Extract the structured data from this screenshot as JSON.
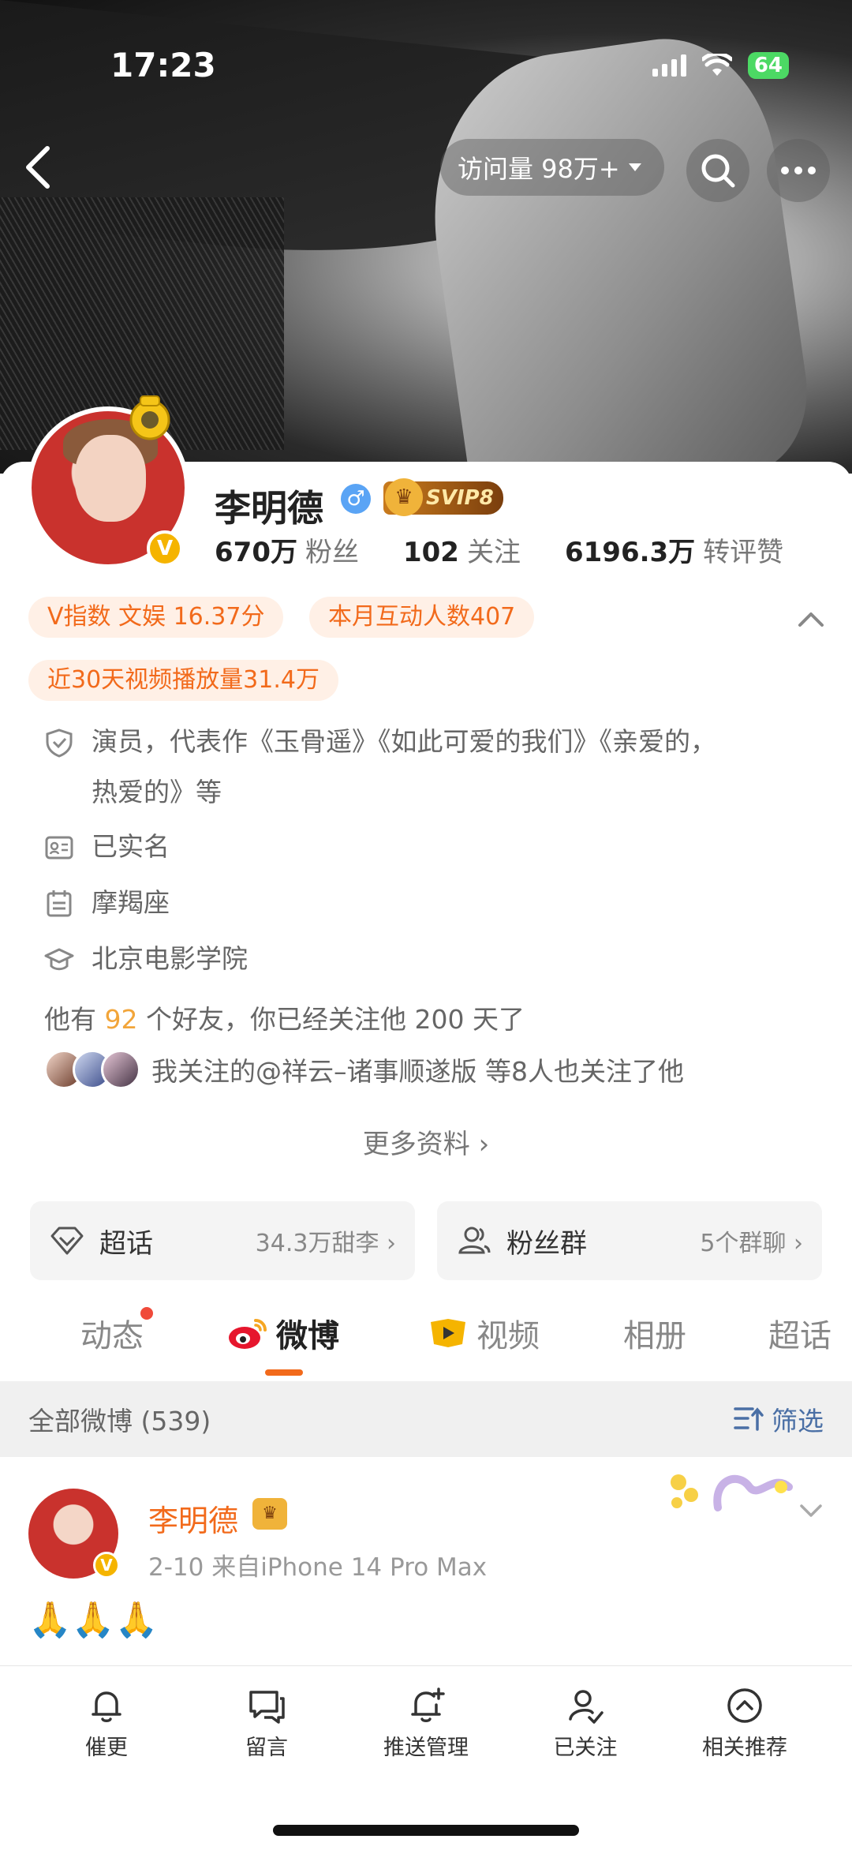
{
  "status_bar": {
    "time": "17:23",
    "battery": "64"
  },
  "top_nav": {
    "visit_label": "访问量 98万+"
  },
  "profile": {
    "name": "李明德",
    "vip_label": "SVIP8",
    "stats": [
      {
        "num": "670万",
        "label": "粉丝"
      },
      {
        "num": "102",
        "label": "关注"
      },
      {
        "num": "6196.3万",
        "label": "转评赞"
      }
    ],
    "tags": [
      "V指数 文娱 16.37分",
      "本月互动人数407",
      "近30天视频播放量31.4万"
    ],
    "info": [
      {
        "icon": "shield-icon",
        "text": "演员，代表作《玉骨遥》《如此可爱的我们》《亲爱的，",
        "text2": "热爱的》等"
      },
      {
        "icon": "id-card-icon",
        "text": "已实名"
      },
      {
        "icon": "calendar-icon",
        "text": "摩羯座"
      },
      {
        "icon": "graduation-cap-icon",
        "text": "北京电影学院"
      }
    ],
    "friends_pre": "他有 ",
    "friends_num": "92",
    "friends_post": " 个好友，你已经关注他 200 天了",
    "mutual_text": "我关注的@祥云–诸事顺遂版 等8人也关注了他",
    "more_info": "更多资料 ›"
  },
  "boxes": [
    {
      "title": "超话",
      "value": "34.3万甜李 ›"
    },
    {
      "title": "粉丝群",
      "value": "5个群聊 ›"
    }
  ],
  "tabs": [
    "动态",
    "微博",
    "视频",
    "相册",
    "超话"
  ],
  "filter": {
    "all": "全部微博 (539)",
    "filter_label": "筛选"
  },
  "post": {
    "name": "李明德",
    "meta": "2-10  来自iPhone 14 Pro Max",
    "body": "🙏🙏🙏"
  },
  "bottom_bar": [
    "催更",
    "留言",
    "推送管理",
    "已关注",
    "相关推荐"
  ],
  "colors": {
    "accent": "#f26a1b",
    "tag_bg": "#fff0e6",
    "link": "#4a6fa5"
  }
}
